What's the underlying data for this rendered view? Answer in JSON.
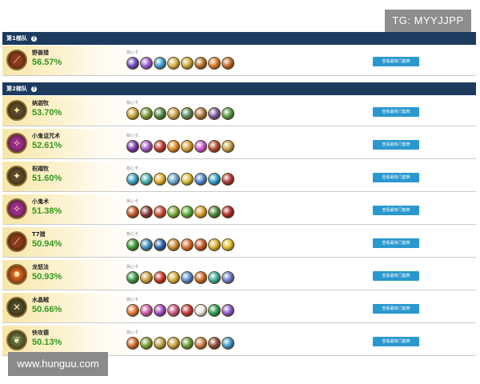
{
  "watermarks": {
    "top_right": "TG: MYYJJPP",
    "bottom_left": "www.hunguu.com"
  },
  "tiers": [
    {
      "label": "第1梯队",
      "help": "?",
      "decks": [
        {
          "name": "野兽猎",
          "winrate": "56.57%",
          "core_label": "核心卡",
          "button": "查看最热门套牌",
          "class_icon": "hunter-icon",
          "class_color": "#8a3a1c",
          "cards": [
            "#6d4dbf",
            "#9a5ad6",
            "#3a9ccf",
            "#d7b04a",
            "#c8a83a",
            "#b86a2a",
            "#d47a2a",
            "#c26a2a"
          ]
        }
      ]
    },
    {
      "label": "第2梯队",
      "help": "?",
      "decks": [
        {
          "name": "纳迦牧",
          "winrate": "53.70%",
          "core_label": "核心卡",
          "button": "查看最热门套牌",
          "class_icon": "priest-icon",
          "class_color": "#5a4a2a",
          "cards": [
            "#c8a83a",
            "#7a9a3a",
            "#4a8a4a",
            "#caa050",
            "#5a8a5a",
            "#b0763a",
            "#7a5aa0",
            "#5a9a4a"
          ]
        },
        {
          "name": "小鬼诅咒术",
          "winrate": "52.61%",
          "core_label": "核心卡",
          "button": "查看最热门套牌",
          "class_icon": "warlock-icon",
          "class_color": "#9a2a8a",
          "cards": [
            "#7a3aaa",
            "#a05ac8",
            "#c23a3a",
            "#e08a2a",
            "#d4a23a",
            "#c85ad0",
            "#b04a2a",
            "#c8a050"
          ]
        },
        {
          "name": "祝福牧",
          "winrate": "51.60%",
          "core_label": "核心卡",
          "button": "查看最热门套牌",
          "class_icon": "priest-icon",
          "class_color": "#5a4a2a",
          "cards": [
            "#3aa0c8",
            "#4ab0b0",
            "#e0b030",
            "#6aa8d0",
            "#d8c040",
            "#4a8ad0",
            "#2aa0d0",
            "#b03a3a"
          ]
        },
        {
          "name": "小鬼术",
          "winrate": "51.38%",
          "core_label": "核心卡",
          "button": "查看最热门套牌",
          "class_icon": "warlock-icon",
          "class_color": "#9a2a8a",
          "cards": [
            "#c25a2a",
            "#8a3a3a",
            "#d04a3a",
            "#7ab03a",
            "#5ab03a",
            "#e0a030",
            "#4a8a3a",
            "#b02a2a"
          ]
        },
        {
          "name": "T7猎",
          "winrate": "50.94%",
          "core_label": "核心卡",
          "button": "查看最热门套牌",
          "class_icon": "hunter-icon",
          "class_color": "#8a3a1c",
          "cards": [
            "#3a9a3a",
            "#3a8ac0",
            "#2a60b0",
            "#c88a3a",
            "#e06a2a",
            "#c85a2a",
            "#d8b030",
            "#e0c030"
          ]
        },
        {
          "name": "龙怒法",
          "winrate": "50.93%",
          "core_label": "核心卡",
          "button": "查看最热门套牌",
          "class_icon": "mage-icon",
          "class_color": "#c85a1a",
          "cards": [
            "#3a9a4a",
            "#caa040",
            "#c83a2a",
            "#d0b040",
            "#5a8ad0",
            "#d06a2a",
            "#3ab0a0",
            "#6a7ad0"
          ]
        },
        {
          "name": "水晶贼",
          "winrate": "50.66%",
          "core_label": "核心卡",
          "button": "查看最热门套牌",
          "class_icon": "rogue-icon",
          "class_color": "#4a4a2a",
          "cards": [
            "#e07a3a",
            "#d05ab0",
            "#a04ac8",
            "#c85a8a",
            "#c83a3a",
            "#e8e8e8",
            "#2aa05a",
            "#8a5ad0"
          ]
        },
        {
          "name": "快攻德",
          "winrate": "50.13%",
          "core_label": "核心卡",
          "button": "查看最热门套牌",
          "class_icon": "druid-icon",
          "class_color": "#5a6a3a",
          "cards": [
            "#d06a2a",
            "#7aa03a",
            "#b8a040",
            "#c8a040",
            "#6a9a3a",
            "#c87a3a",
            "#8a4a3a",
            "#3a9ad0"
          ]
        }
      ]
    }
  ]
}
